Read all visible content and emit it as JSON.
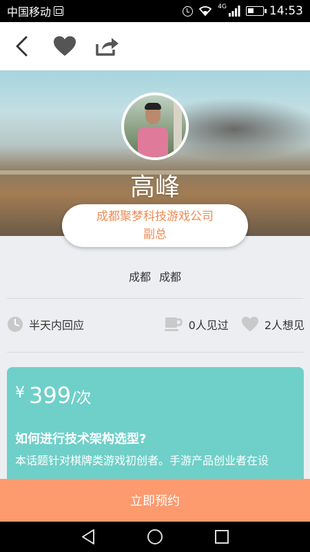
{
  "status_bar": {
    "carrier": "中国移动",
    "network": "4G",
    "time": "14:53"
  },
  "toolbar": {
    "icons": [
      "back-icon",
      "heart-icon",
      "share-icon"
    ]
  },
  "profile": {
    "name": "高峰",
    "company": "成都聚梦科技游戏公司",
    "title": "副总",
    "location_province": "成都",
    "location_city": "成都"
  },
  "stats": {
    "reply_time": "半天内回应",
    "met_count": "0人见过",
    "want_count": "2人想见"
  },
  "topic": {
    "currency": "¥",
    "price": "399",
    "unit": "/次",
    "title": "如何进行技术架构选型?",
    "description": "本话题针对棋牌类游戏初创者。手游产品创业者在设"
  },
  "book_button": {
    "label": "立即预约"
  },
  "colors": {
    "accent_orange": "#fd9a6e",
    "company_text": "#ef8b55",
    "card_teal": "#6fd0c9"
  }
}
